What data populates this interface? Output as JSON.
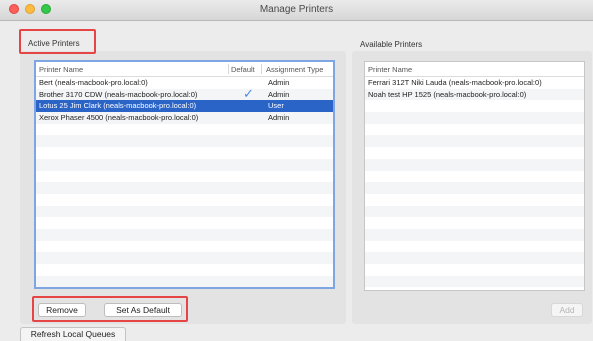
{
  "window": {
    "title": "Manage Printers"
  },
  "active": {
    "label": "Active Printers",
    "columns": {
      "name": "Printer Name",
      "default": "Default",
      "type": "Assignment Type"
    },
    "rows": [
      {
        "name": "Bert (neals-macbook-pro.local:0)",
        "type": "Admin"
      },
      {
        "name": "Brother 3170 CDW (neals-macbook-pro.local:0)",
        "type": "Admin",
        "default": true
      },
      {
        "name": "Lotus 25 Jim Clark (neals-macbook-pro.local:0)",
        "type": "User",
        "selected": true
      },
      {
        "name": "Xerox Phaser 4500 (neals-macbook-pro.local:0)",
        "type": "Admin"
      }
    ],
    "remove_label": "Remove",
    "set_default_label": "Set As Default"
  },
  "available": {
    "label": "Available Printers",
    "columns": {
      "name": "Printer Name"
    },
    "rows": [
      {
        "name": "Ferrari 312T Niki Lauda (neals-macbook-pro.local:0)"
      },
      {
        "name": "Noah test HP 1525 (neals-macbook-pro.local:0)"
      }
    ],
    "add_label": "Add"
  },
  "refresh_label": "Refresh Local Queues",
  "colors": {
    "selection": "#2b64c7",
    "check": "#4a8be0",
    "highlight": "#e64545"
  },
  "icons": {
    "default_marker": "checkmark-icon"
  }
}
